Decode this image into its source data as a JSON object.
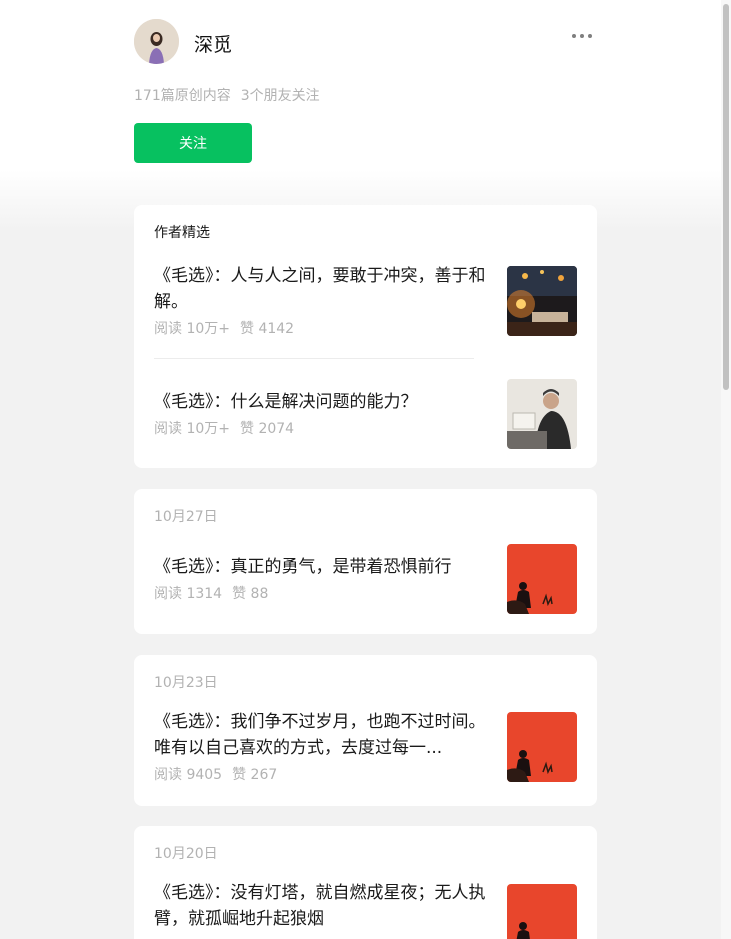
{
  "account": {
    "name": "深觅",
    "stats": [
      "171篇原创内容",
      "3个朋友关注"
    ],
    "follow_label": "关注"
  },
  "featured": {
    "title": "作者精选",
    "articles": [
      {
        "title": "《毛选》：人与人之间，要敢于冲突，善于和解。",
        "reads": "阅读 10万+",
        "likes": "赞 4142",
        "thumb": "desk-lamp-image"
      },
      {
        "title": "《毛选》：什么是解决问题的能力？",
        "reads": "阅读 10万+",
        "likes": "赞 2074",
        "thumb": "man-reading-image"
      }
    ]
  },
  "groups": [
    {
      "date": "10月27日",
      "article": {
        "title": "《毛选》：真正的勇气，是带着恐惧前行",
        "reads": "阅读 1314",
        "likes": "赞 88"
      }
    },
    {
      "date": "10月23日",
      "article": {
        "title": "《毛选》：我们争不过岁月，也跑不过时间。唯有以自己喜欢的方式，去度过每一...",
        "reads": "阅读 9405",
        "likes": "赞 267"
      }
    },
    {
      "date": "10月20日",
      "article": {
        "title": "《毛选》：没有灯塔，就自燃成星夜；无人执臂，就孤崛地升起狼烟",
        "reads": "",
        "likes": ""
      }
    }
  ],
  "colors": {
    "accent": "#07c160",
    "muted": "#b2b2b2",
    "red_thumb": "#e8462c"
  }
}
